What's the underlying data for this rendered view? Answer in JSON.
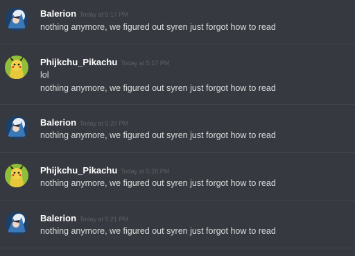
{
  "messages": [
    {
      "author": "Balerion",
      "timestamp": "Today at 5:17 PM",
      "avatar_icon": "anime-character-avatar-icon",
      "lines": [
        "nothing anymore, we figured out syren just forgot how to read"
      ]
    },
    {
      "author": "Phijkchu_Pikachu",
      "timestamp": "Today at 5:17 PM",
      "avatar_icon": "pikachu-avatar-icon",
      "lines": [
        "lol",
        "nothing anymore, we figured out syren just forgot how to read"
      ]
    },
    {
      "author": "Balerion",
      "timestamp": "Today at 5:20 PM",
      "avatar_icon": "anime-character-avatar-icon",
      "lines": [
        "nothing anymore, we figured out syren just forgot how to read"
      ]
    },
    {
      "author": "Phijkchu_Pikachu",
      "timestamp": "Today at 5:20 PM",
      "avatar_icon": "pikachu-avatar-icon",
      "lines": [
        "nothing anymore, we figured out syren just forgot how to read"
      ]
    },
    {
      "author": "Balerion",
      "timestamp": "Today at 5:21 PM",
      "avatar_icon": "anime-character-avatar-icon",
      "lines": [
        "nothing anymore, we figured out syren just forgot how to read"
      ]
    }
  ],
  "colors": {
    "background": "#36393f",
    "username": "#ffffff",
    "message_text": "#dcddde",
    "timestamp": "#5d6066",
    "divider": "#42454a"
  }
}
